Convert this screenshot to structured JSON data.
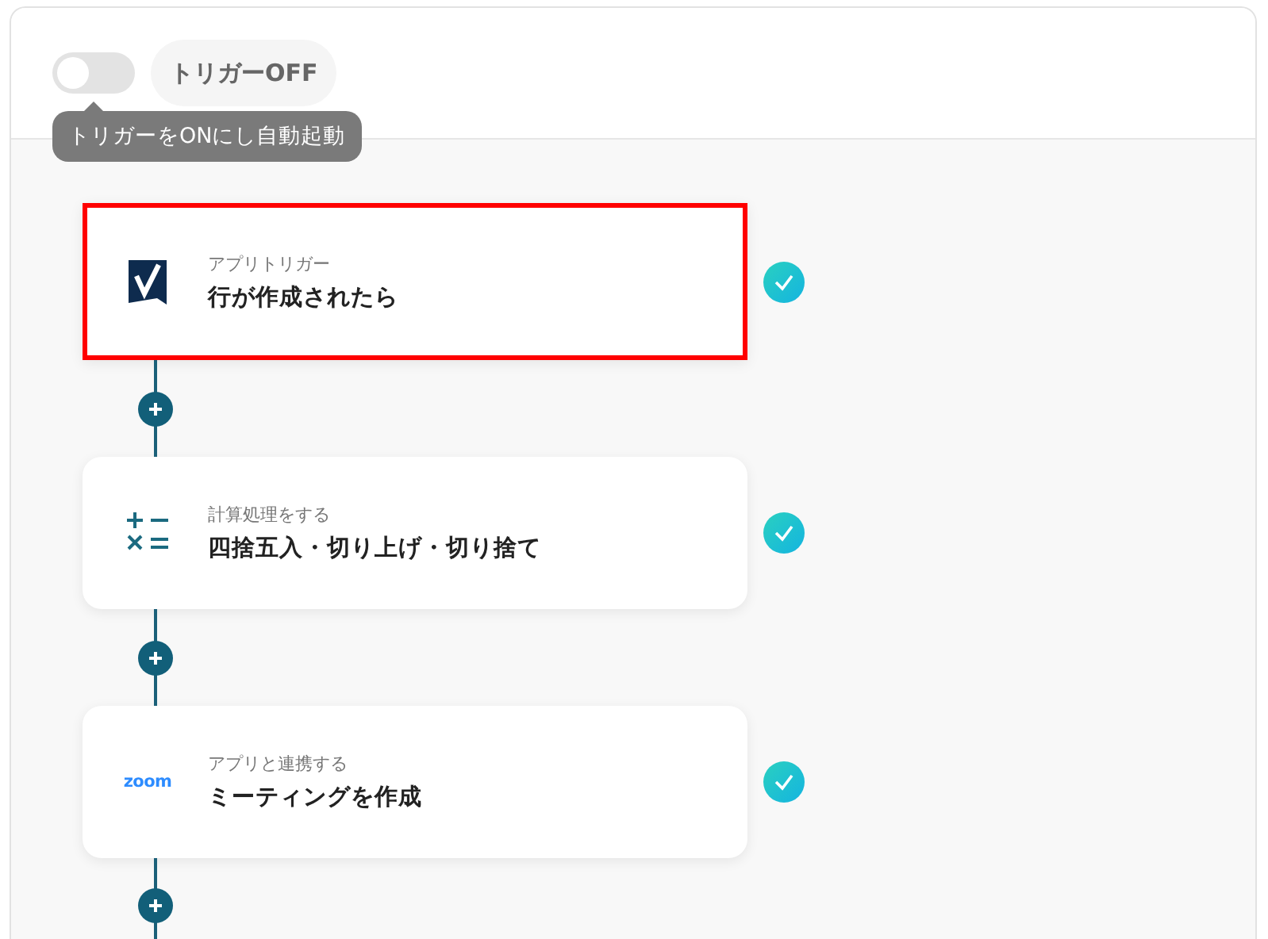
{
  "trigger": {
    "on": false,
    "label": "トリガーOFF",
    "tooltip": "トリガーをONにし自動起動"
  },
  "steps": [
    {
      "kind": "sheet",
      "category": "アプリトリガー",
      "title": "行が作成されたら",
      "selected": true,
      "completed": true
    },
    {
      "kind": "calc",
      "category": "計算処理をする",
      "title": "四捨五入・切り上げ・切り捨て",
      "selected": false,
      "completed": true
    },
    {
      "kind": "logo",
      "logo": "zoom",
      "category": "アプリと連携する",
      "title": "ミーティングを作成",
      "selected": false,
      "completed": true
    }
  ]
}
